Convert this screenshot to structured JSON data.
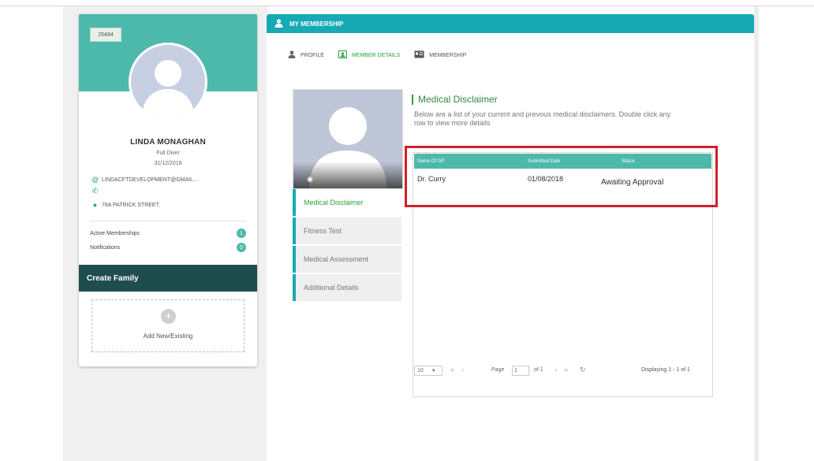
{
  "profile": {
    "id_badge": "25484",
    "name": "LINDA MONAGHAN",
    "membership_type": "Full Diver",
    "date": "31/12/2018",
    "email": "LINDACFTDEVELOPMENT@GMAIL...",
    "phone": "",
    "address": "78A PATRICK STREET,",
    "stats": [
      {
        "label": "Active Memberships",
        "count": "1"
      },
      {
        "label": "Notifications",
        "count": "0"
      }
    ],
    "family_bar": "Create Family",
    "add_label": "Add New/Existing"
  },
  "main": {
    "title": "MY MEMBERSHIP",
    "tabs": [
      {
        "label": "PROFILE",
        "icon": "person-icon"
      },
      {
        "label": "MEMBER DETAILS",
        "icon": "id-card-icon",
        "active": true
      },
      {
        "label": "MEMBERSHIP",
        "icon": "membership-card-icon"
      }
    ],
    "side_nav": [
      {
        "label": "Medical Disclaimer",
        "active": true
      },
      {
        "label": "Fitness Test"
      },
      {
        "label": "Medical Assessment"
      },
      {
        "label": "Additional Details"
      }
    ],
    "section_title": "Medical Disclaimer",
    "section_desc": "Below are a list of your current and prevous medical disclaimers. Double click any row to view more details",
    "grid": {
      "columns": [
        "Name Of GP",
        "Submitted Date",
        "Status"
      ],
      "rows": [
        {
          "gp": "Dr. Curry",
          "date": "01/08/2018",
          "status": "Awaiting Approval"
        }
      ]
    },
    "pager": {
      "page_size": "10",
      "page_label": "Page",
      "page_value": "1",
      "of_label": "of 1",
      "display_text": "Displaying 1 - 1 of 1"
    }
  },
  "colors": {
    "teal": "#4db9ab",
    "header_teal": "#17a9b4",
    "dark_bar": "#1f4d4e",
    "active_green": "#2aa03a",
    "highlight_red": "#d11f2a"
  }
}
